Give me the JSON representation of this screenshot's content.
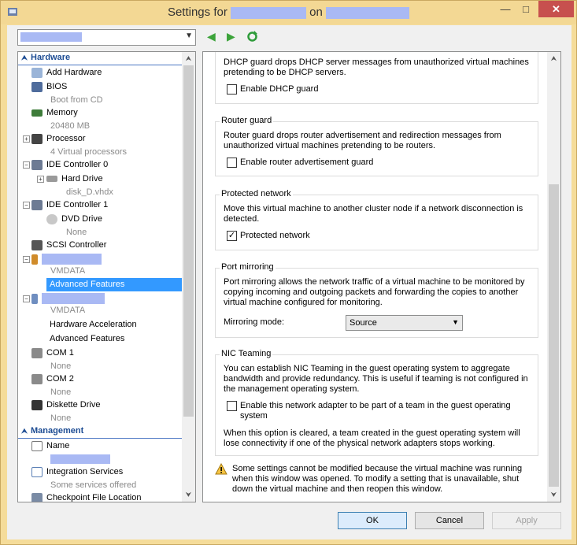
{
  "window": {
    "title_prefix": "Settings for",
    "title_mid": "on",
    "minimize_glyph": "—",
    "maximize_glyph": "□",
    "close_glyph": "✕"
  },
  "colors": {
    "title_bar": "#f3d894",
    "selection": "#3399ff",
    "category_text": "#1e4d94",
    "close_button": "#c7504e"
  },
  "icons": {
    "back": "back-arrow-icon",
    "forward": "forward-arrow-icon",
    "refresh": "refresh-icon",
    "warning": "warning-icon"
  },
  "tree": {
    "hardware_label": "Hardware",
    "add_hardware": "Add Hardware",
    "bios": "BIOS",
    "bios_sub": "Boot from CD",
    "memory": "Memory",
    "memory_sub": "20480 MB",
    "processor": "Processor",
    "processor_sub": "4 Virtual processors",
    "ide0": "IDE Controller 0",
    "hard_drive": "Hard Drive",
    "hard_drive_sub": "disk_D.vhdx",
    "ide1": "IDE Controller 1",
    "dvd": "DVD Drive",
    "dvd_sub": "None",
    "scsi": "SCSI Controller",
    "nic1_sub": "VMDATA",
    "nic1_adv": "Advanced Features",
    "nic2_sub": "VMDATA",
    "nic2_hw_accel": "Hardware Acceleration",
    "nic2_adv": "Advanced Features",
    "com1": "COM 1",
    "com1_sub": "None",
    "com2": "COM 2",
    "com2_sub": "None",
    "diskette": "Diskette Drive",
    "diskette_sub": "None",
    "management_label": "Management",
    "name": "Name",
    "integration": "Integration Services",
    "integration_sub": "Some services offered",
    "checkpoint": "Checkpoint File Location"
  },
  "settings": {
    "dhcp_desc": "DHCP guard drops DHCP server messages from unauthorized virtual machines pretending to be DHCP servers.",
    "dhcp_check_label": "Enable DHCP guard",
    "dhcp_checked": false,
    "router_title": "Router guard",
    "router_desc": "Router guard drops router advertisement and redirection messages from unauthorized virtual machines pretending to be routers.",
    "router_check_label": "Enable router advertisement guard",
    "router_checked": false,
    "protected_title": "Protected network",
    "protected_desc": "Move this virtual machine to another cluster node if a network disconnection is detected.",
    "protected_check_label": "Protected network",
    "protected_checked": true,
    "mirroring_title": "Port mirroring",
    "mirroring_desc": "Port mirroring allows the network traffic of a virtual machine to be monitored by copying incoming and outgoing packets and forwarding the copies to another virtual machine configured for monitoring.",
    "mirroring_mode_label": "Mirroring mode:",
    "mirroring_mode_value": "Source",
    "teaming_title": "NIC Teaming",
    "teaming_desc": "You can establish NIC Teaming in the guest operating system to aggregate bandwidth and provide redundancy. This is useful if teaming is not configured in the management operating system.",
    "teaming_check_label": "Enable this network adapter to be part of a team in the guest operating system",
    "teaming_checked": false,
    "teaming_note": "When this option is cleared, a team created in the guest operating system will lose connectivity if one of the physical network adapters stops working.",
    "warning_text": "Some settings cannot be modified because the virtual machine was running when this window was opened. To modify a setting that is unavailable, shut down the virtual machine and then reopen this window."
  },
  "buttons": {
    "ok": "OK",
    "cancel": "Cancel",
    "apply": "Apply"
  }
}
